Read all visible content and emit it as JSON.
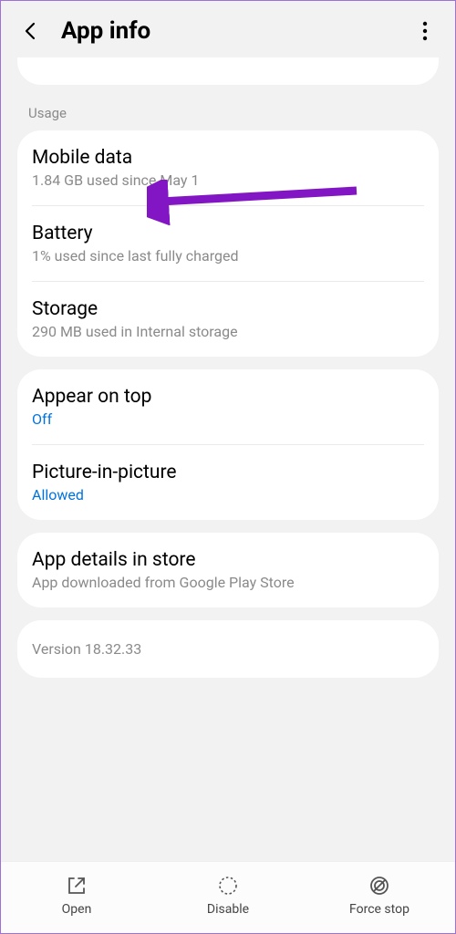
{
  "header": {
    "title": "App info"
  },
  "section_label": "Usage",
  "usage": {
    "mobile_data": {
      "title": "Mobile data",
      "sub": "1.84 GB used since May 1"
    },
    "battery": {
      "title": "Battery",
      "sub": "1% used since last fully charged"
    },
    "storage": {
      "title": "Storage",
      "sub": "290 MB used in Internal storage"
    }
  },
  "overlay": {
    "appear_on_top": {
      "title": "Appear on top",
      "value": "Off"
    },
    "pip": {
      "title": "Picture-in-picture",
      "value": "Allowed"
    }
  },
  "store": {
    "title": "App details in store",
    "sub": "App downloaded from Google Play Store"
  },
  "version": "Version 18.32.33",
  "bottom": {
    "open": "Open",
    "disable": "Disable",
    "force_stop": "Force stop"
  },
  "annotation": {
    "color": "#8316c4"
  }
}
